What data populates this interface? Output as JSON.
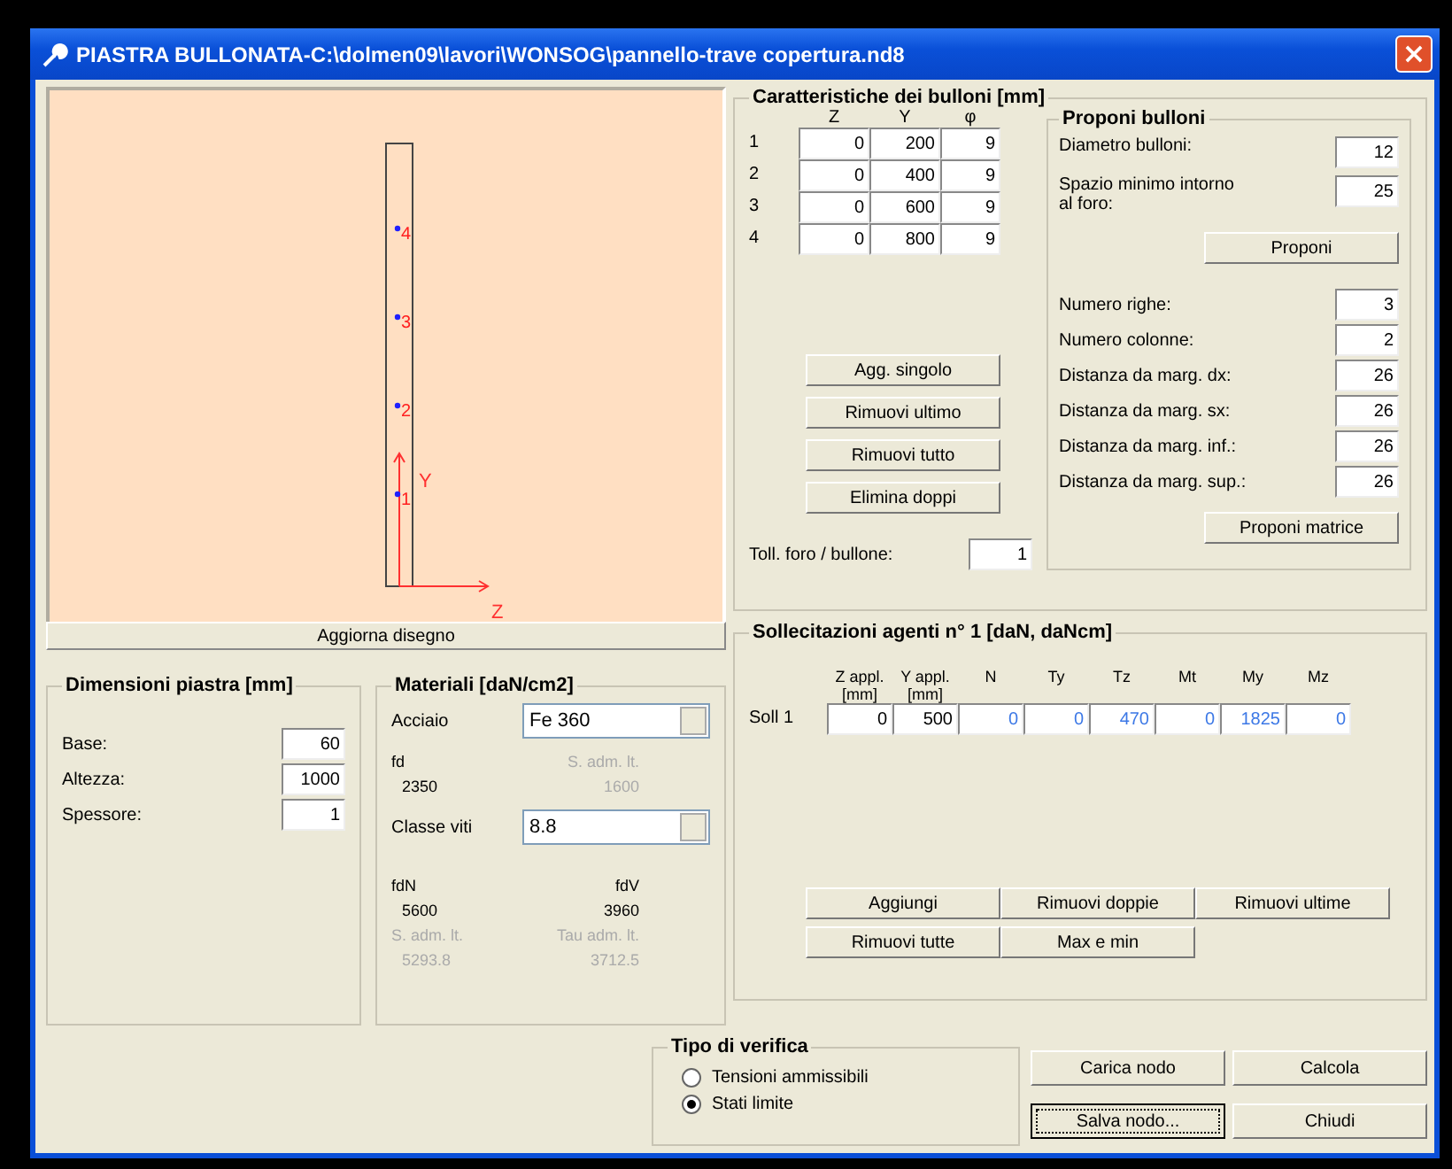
{
  "window": {
    "title": "PIASTRA BULLONATA-C:\\dolmen09\\lavori\\WONSOG\\pannello-trave copertura.nd8"
  },
  "drawing": {
    "bolt_labels": [
      "4",
      "3",
      "2",
      "1"
    ],
    "y_axis_label": "Y",
    "z_axis_label": "Z"
  },
  "refresh_button": "Aggiorna disegno",
  "plate_dimensions": {
    "title": "Dimensioni piastra [mm]",
    "fields": [
      {
        "label": "Base:",
        "value": "60"
      },
      {
        "label": "Altezza:",
        "value": "1000"
      },
      {
        "label": "Spessore:",
        "value": "1"
      }
    ]
  },
  "materials": {
    "title": "Materiali [daN/cm2]",
    "steel": {
      "label": "Acciaio",
      "value": "Fe 360"
    },
    "steel_props": [
      {
        "label": "fd",
        "value": "2350",
        "disabled": false
      },
      {
        "label": "S. adm. lt.",
        "value": "1600",
        "disabled": true
      }
    ],
    "bolt_class": {
      "label": "Classe viti",
      "value": "8.8"
    },
    "bolt_props": [
      {
        "label": "fdN",
        "value": "5600",
        "disabled": false
      },
      {
        "label": "fdV",
        "value": "3960",
        "disabled": false
      },
      {
        "label": "S. adm. lt.",
        "value": "5293.8",
        "disabled": true
      },
      {
        "label": "Tau adm. lt.",
        "value": "3712.5",
        "disabled": true
      }
    ]
  },
  "bolts": {
    "title": "Caratteristiche dei bulloni [mm]",
    "columns": [
      "Z",
      "Y",
      "φ"
    ],
    "rows": [
      {
        "label": "1",
        "values": [
          "0",
          "200",
          "9"
        ]
      },
      {
        "label": "2",
        "values": [
          "0",
          "400",
          "9"
        ]
      },
      {
        "label": "3",
        "values": [
          "0",
          "600",
          "9"
        ]
      },
      {
        "label": "4",
        "values": [
          "0",
          "800",
          "9"
        ]
      }
    ],
    "buttons": [
      "Agg. singolo",
      "Rimuovi ultimo",
      "Rimuovi tutto",
      "Elimina doppi"
    ],
    "tolerance": {
      "label": "Toll. foro / bullone:",
      "value": "1"
    },
    "propose": {
      "title": "Proponi bulloni",
      "fields": [
        {
          "label": "Diametro bulloni:",
          "value": "12"
        },
        {
          "label": "Spazio minimo intorno al foro:",
          "value": "25"
        }
      ],
      "button": "Proponi",
      "matrix_fields": [
        {
          "label": "Numero righe:",
          "value": "3"
        },
        {
          "label": "Numero colonne:",
          "value": "2"
        },
        {
          "label": "Distanza da marg. dx:",
          "value": "26"
        },
        {
          "label": "Distanza da marg. sx:",
          "value": "26"
        },
        {
          "label": "Distanza da marg. inf.:",
          "value": "26"
        },
        {
          "label": "Distanza da marg. sup.:",
          "value": "26"
        }
      ],
      "matrix_button": "Proponi matrice"
    }
  },
  "loads": {
    "title": "Sollecitazioni agenti n° 1 [daN, daNcm]",
    "columns": [
      "Z appl. [mm]",
      "Y appl. [mm]",
      "N",
      "Ty",
      "Tz",
      "Mt",
      "My",
      "Mz"
    ],
    "rows": [
      {
        "label": "Soll 1",
        "cells": [
          {
            "value": "0",
            "color": "#000000"
          },
          {
            "value": "500",
            "color": "#000000"
          },
          {
            "value": "0",
            "color": "#3c78e6"
          },
          {
            "value": "0",
            "color": "#3c78e6"
          },
          {
            "value": "470",
            "color": "#3c78e6"
          },
          {
            "value": "0",
            "color": "#3c78e6"
          },
          {
            "value": "1825",
            "color": "#3c78e6"
          },
          {
            "value": "0",
            "color": "#3c78e6"
          }
        ]
      }
    ],
    "buttons": [
      "Aggiungi",
      "Rimuovi doppie",
      "Rimuovi ultime",
      "Rimuovi tutte",
      "Max e min"
    ]
  },
  "verification": {
    "title": "Tipo di verifica",
    "options": [
      {
        "label": "Tensioni ammissibili",
        "selected": false
      },
      {
        "label": "Stati limite",
        "selected": true
      }
    ]
  },
  "actions": [
    {
      "label": "Carica nodo",
      "focused": false
    },
    {
      "label": "Calcola",
      "focused": false
    },
    {
      "label": "Salva nodo...",
      "focused": true
    },
    {
      "label": "Chiudi",
      "focused": false
    }
  ]
}
